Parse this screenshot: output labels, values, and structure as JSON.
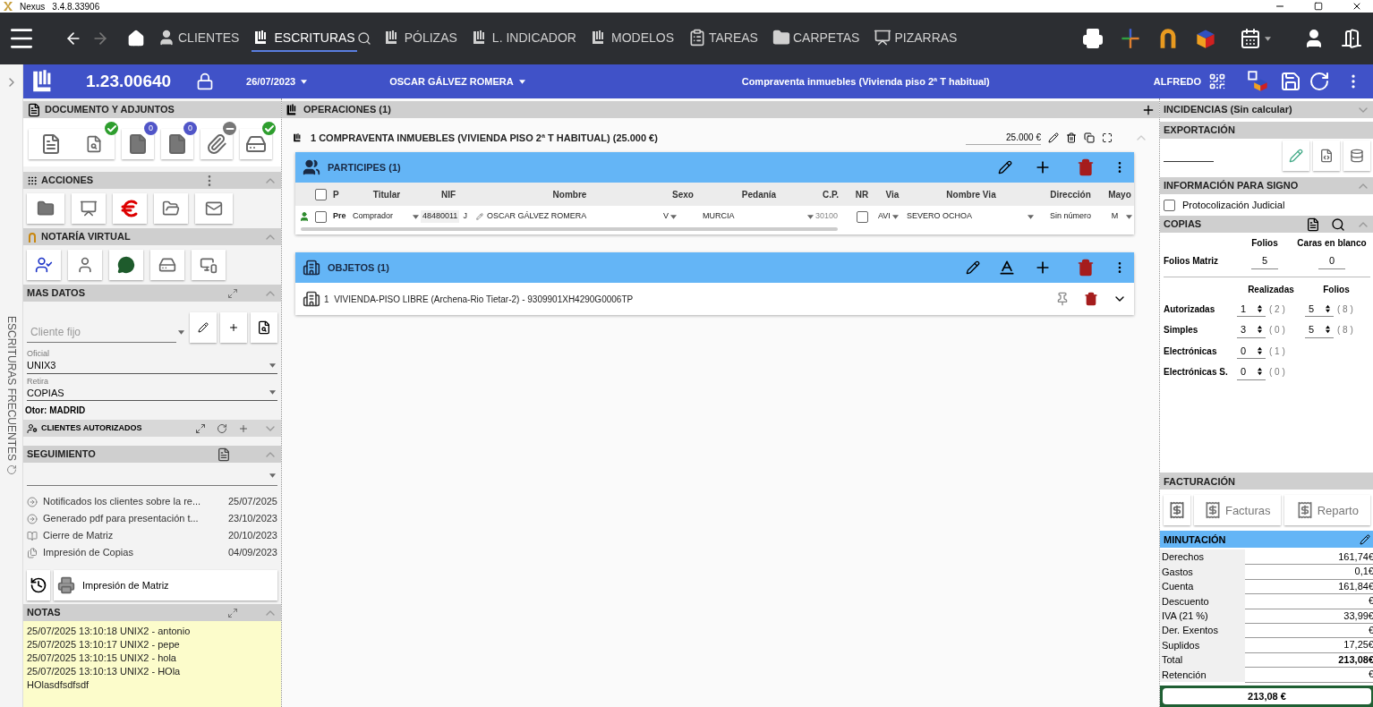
{
  "window": {
    "title": "Nexus",
    "version": "3.4.8.33906"
  },
  "nav": {
    "items": [
      {
        "kind": "clientes",
        "label": "CLIENTES",
        "selected": false
      },
      {
        "kind": "escrituras",
        "label": "ESCRITURAS",
        "selected": true
      },
      {
        "kind": "polizas",
        "label": "PÓLIZAS",
        "selected": false
      },
      {
        "kind": "indicador",
        "label": "L. INDICADOR",
        "selected": false
      },
      {
        "kind": "modelos",
        "label": "MODELOS",
        "selected": false
      },
      {
        "kind": "tareas",
        "label": "TAREAS",
        "selected": false
      },
      {
        "kind": "carpetas",
        "label": "CARPETAS",
        "selected": false
      },
      {
        "kind": "pizarras",
        "label": "PIZARRAS",
        "selected": false
      }
    ]
  },
  "header": {
    "number": "1.23.00640",
    "date": "26/07/2023",
    "client": "OSCAR GÁLVEZ ROMERA",
    "title": "Compraventa inmuebles (Vivienda piso 2ª T habitual)",
    "user": "ALFREDO"
  },
  "side_tab": {
    "label": "ESCRITURAS FRECUENTES"
  },
  "left": {
    "documento": {
      "title": "DOCUMENTO Y ADJUNTOS",
      "buttons": [
        {
          "kind": "word",
          "checked": true
        },
        {
          "kind": "d",
          "count": "0"
        },
        {
          "kind": "n",
          "count": "0"
        },
        {
          "kind": "clip",
          "disabled": true
        },
        {
          "kind": "ard",
          "checked": true
        }
      ]
    },
    "acciones": {
      "title": "ACCIONES"
    },
    "notaria": {
      "title": "NOTARÍA VIRTUAL"
    },
    "mas_datos": {
      "title": "MAS DATOS",
      "cliente_fijo": {
        "placeholder": "Cliente fijo"
      },
      "oficial": {
        "label": "Oficial",
        "value": "UNIX3"
      },
      "retira": {
        "label": "Retira",
        "value": "COPIAS"
      },
      "otor": "Otor: MADRID",
      "clientes_autorizados": {
        "title": "CLIENTES AUTORIZADOS",
        "expanded": false
      }
    },
    "seguimiento": {
      "title": "SEGUIMIENTO",
      "items": [
        {
          "kind": "aviso",
          "text": "Notificados los clientes sobre la re...",
          "date": "25/07/2025"
        },
        {
          "kind": "aviso",
          "text": "Generado pdf para presentación t...",
          "date": "23/10/2023"
        },
        {
          "kind": "matriz",
          "text": "Cierre de Matriz",
          "date": "20/10/2023"
        },
        {
          "kind": "copias",
          "text": "Impresión de Copias",
          "date": "04/09/2023"
        }
      ],
      "action": "Impresión de Matriz"
    },
    "notas": {
      "title": "NOTAS",
      "lines": [
        "25/07/2025 13:10:18 UNIX2 - antonio",
        "25/07/2025 13:10:17 UNIX2 - pepe",
        "25/07/2025 13:10:15 UNIX2 - hola",
        "25/07/2025 13:10:13 UNIX2 - HOla",
        "HOlasdfsdfsdf"
      ]
    }
  },
  "operaciones": {
    "title": "OPERACIONES (1)",
    "operation": {
      "title": "1 COMPRAVENTA INMUEBLES (VIVIENDA PISO 2ª T HABITUAL) (25.000 €)",
      "amount": "25.000 €"
    },
    "participes": {
      "title": "PARTICIPES (1)",
      "all_checked": false,
      "columns": [
        "P",
        "Titular",
        "NIF",
        "Nombre",
        "Sexo",
        "Pedanía",
        "C.P.",
        "NR",
        "Via",
        "Nombre Via",
        "Dirección",
        "Mayo"
      ],
      "rows": [
        {
          "checked": false,
          "p": "Pre",
          "titular": "Comprador",
          "nif": "48480011",
          "nif_letter": "J",
          "nombre": "OSCAR GÁLVEZ ROMERA",
          "sexo": "V",
          "pedania": "MURCIA",
          "cp": "30100",
          "nr": false,
          "via": "AVI",
          "nombre_via": "SEVERO OCHOA",
          "direccion": "Sin número",
          "mayor": "M"
        }
      ]
    },
    "objetos": {
      "title": "OBJETOS (1)",
      "items": [
        {
          "number": "1",
          "text": "VIVIENDA-PISO LIBRE (Archena-Rio Tietar-2) - 9309901XH4290G0006TP"
        }
      ]
    }
  },
  "right": {
    "incidencias": {
      "title": "INCIDENCIAS (Sin calcular)"
    },
    "exportacion": {
      "title": "EXPORTACIÓN"
    },
    "info_signo": {
      "title": "INFORMACIÓN PARA SIGNO",
      "protocolizacion": {
        "label": "Protocolización Judicial",
        "checked": false
      }
    },
    "copias": {
      "title": "COPIAS",
      "matriz_columns": [
        "Folios",
        "Caras en blanco"
      ],
      "matriz": {
        "label": "Folios Matriz",
        "folios": "5",
        "caras": "0"
      },
      "columns": [
        "Realizadas",
        "Folios"
      ],
      "rows": [
        {
          "label": "Autorizadas",
          "realizadas": "1",
          "realizadas_total": "( 2 )",
          "folios": "5",
          "folios_total": "( 8 )"
        },
        {
          "label": "Simples",
          "realizadas": "3",
          "realizadas_total": "( 0 )",
          "folios": "5",
          "folios_total": "( 8 )"
        },
        {
          "label": "Electrónicas",
          "realizadas": "0",
          "realizadas_total": "( 1 )"
        },
        {
          "label": "Electrónicas S.",
          "realizadas": "0",
          "realizadas_total": "( 0 )"
        }
      ]
    },
    "facturacion": {
      "title": "FACTURACIÓN",
      "buttons": [
        "Facturas",
        "Reparto"
      ]
    },
    "minutacion": {
      "title": "MINUTACIÓN",
      "rows": [
        {
          "label": "Derechos",
          "value": "161,74€",
          "bold": false
        },
        {
          "label": "Gastos",
          "value": "0,1€",
          "bold": false
        },
        {
          "label": "Cuenta",
          "value": "161,84€",
          "bold": false
        },
        {
          "label": "Descuento",
          "value": "€",
          "bold": false
        },
        {
          "label": "IVA (21 %)",
          "value": "33,99€",
          "bold": false
        },
        {
          "label": "Der. Exentos",
          "value": "€",
          "bold": false
        },
        {
          "label": "Suplidos",
          "value": "17,25€",
          "bold": false
        },
        {
          "label": "Total",
          "value": "213,08€",
          "bold": true
        },
        {
          "label": "Retención",
          "value": "€",
          "bold": false
        }
      ],
      "total": "213,08 €"
    }
  }
}
